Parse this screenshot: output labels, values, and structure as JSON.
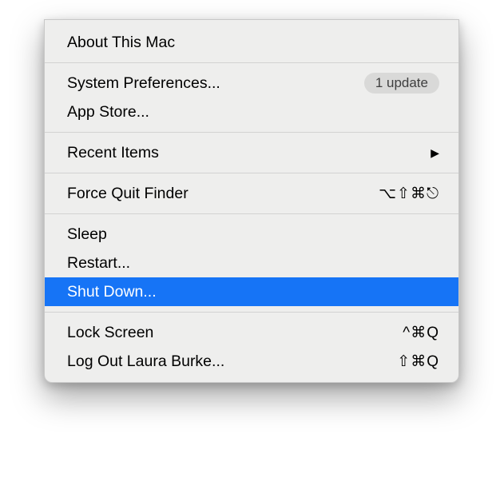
{
  "menu": {
    "about": "About This Mac",
    "system_preferences": "System Preferences...",
    "update_badge": "1 update",
    "app_store": "App Store...",
    "recent_items": "Recent Items",
    "force_quit": "Force Quit Finder",
    "force_quit_shortcut": "⌥⇧⌘⎋",
    "sleep": "Sleep",
    "restart": "Restart...",
    "shut_down": "Shut Down...",
    "lock_screen": "Lock Screen",
    "lock_screen_shortcut": "^⌘Q",
    "log_out": "Log Out Laura Burke...",
    "log_out_shortcut": "⇧⌘Q",
    "submenu_arrow": "▶"
  }
}
